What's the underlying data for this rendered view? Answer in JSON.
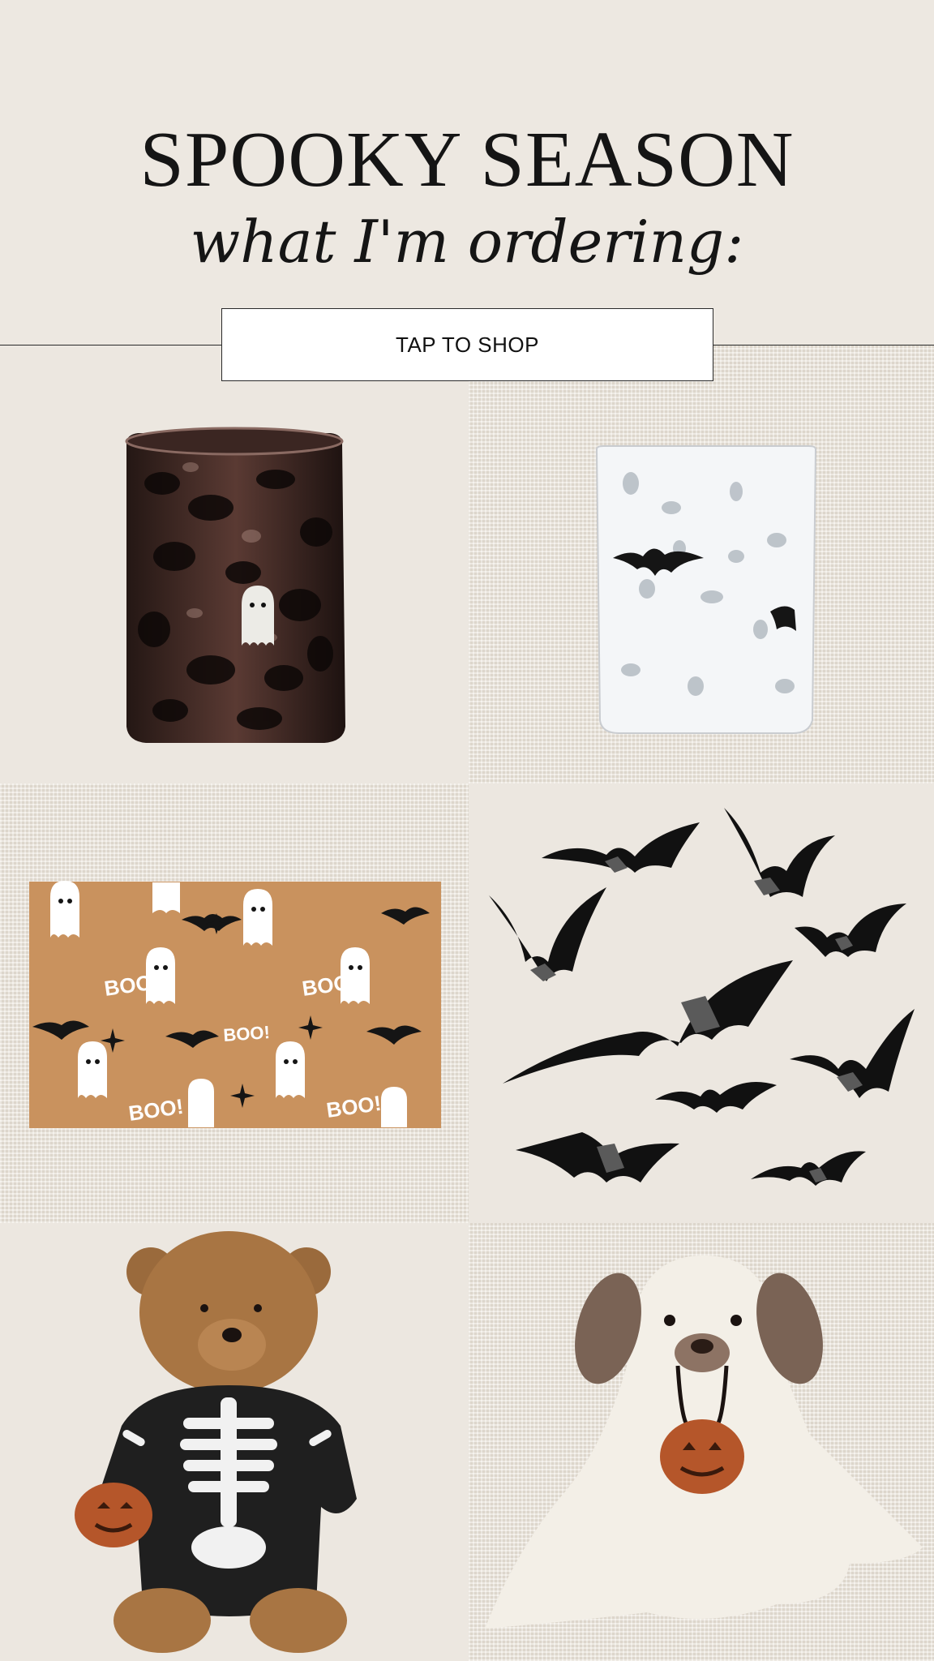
{
  "header": {
    "title": "SPOOKY SEASON",
    "subtitle": "what I'm ordering:"
  },
  "cta": {
    "label": "TAP TO SHOP"
  },
  "products": [
    {
      "name": "Tortoiseshell ghost glass tumbler",
      "icon": "ghost-tumbler-image"
    },
    {
      "name": "White confetti bat glass tumbler",
      "icon": "bat-tumbler-image"
    },
    {
      "name": "Ghost and bat BOO doormat",
      "icon": "boo-doormat-image",
      "mat_text": "BOO!"
    },
    {
      "name": "Bat wall decals",
      "icon": "bat-decals-image"
    },
    {
      "name": "Skeleton teddy bear with pumpkin",
      "icon": "skeleton-bear-image"
    },
    {
      "name": "Puppy ghost lovey with pumpkin",
      "icon": "ghost-puppy-image"
    }
  ],
  "colors": {
    "background": "#ede8e1",
    "text": "#151515",
    "divider": "#2a2a2a",
    "button": "#ffffff"
  }
}
